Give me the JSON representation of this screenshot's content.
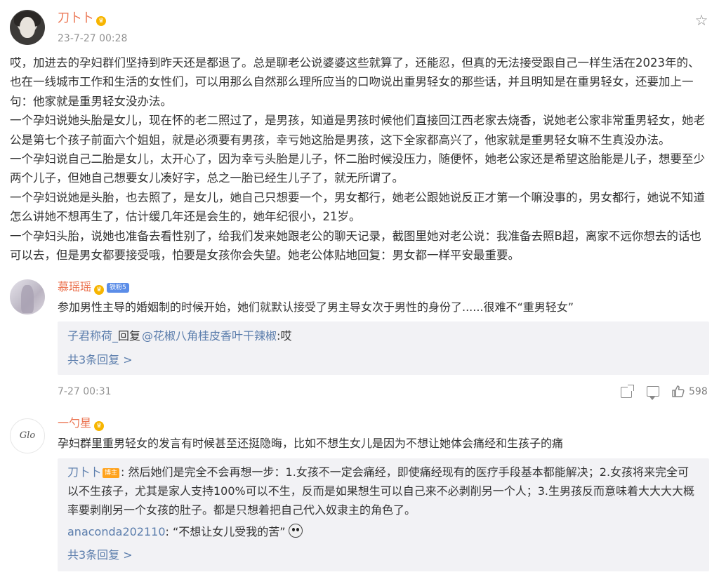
{
  "post": {
    "author": "刀卜卜",
    "time": "23-7-27 00:28",
    "paragraphs": [
      "哎，加进去的孕妇群们坚持到昨天还是都退了。总是聊老公说婆婆这些就算了，还能忍，但真的无法接受跟自己一样生活在2023年的、也在一线城市工作和生活的女性们，可以用那么自然那么理所应当的口吻说出重男轻女的那些话，并且明知是在重男轻女，还要加上一句：他家就是重男轻女没办法。",
      "一个孕妇说她头胎是女儿，现在怀的老二照过了，是男孩，知道是男孩时候他们直接回江西老家去烧香，说她老公家非常重男轻女，她老公是第七个孩子前面六个姐姐，就是必须要有男孩，幸亏她这胎是男孩，这下全家都高兴了，他家就是重男轻女嘛不生真没办法。",
      "一个孕妇说自己二胎是女儿，太开心了，因为幸亏头胎是儿子，怀二胎时候没压力，随便怀，她老公家还是希望这胎能是儿子，想要至少两个儿子，但她自己想要女儿凑好字，总之一胎已经生儿子了，就无所谓了。",
      "一个孕妇说她是头胎，也去照了，是女儿，她自己只想要一个，男女都行，她老公跟她说反正才第一个嘛没事的，男女都行，她说不知道怎么讲她不想再生了，估计缓几年还是会生的，她年纪很小，21岁。",
      "一个孕妇头胎，说她也准备去看性别了，给我们发来她跟老公的聊天记录，截图里她对老公说：我准备去照B超，离家不远你想去的话也可以去，但是男女都要接受哦，怕要是女孩你会失望。她老公体贴地回复：男女都一样平安最重要。"
    ]
  },
  "comments": [
    {
      "name": "慕瑶瑶",
      "fan_badge": "铁粉5",
      "text": "参加男性主导的婚姻制的时候开始，她们就默认接受了男主导女次于男性的身份了......很难不“重男轻女”",
      "reply_user": "子君称荷_",
      "reply_verb": "回复",
      "reply_mention": "@花椒八角桂皮香叶干辣椒",
      "reply_text": ":哎",
      "more_replies": "共3条回复 >",
      "time": "7-27 00:31",
      "likes": "598"
    },
    {
      "name": "一勺星",
      "avatar_text": "Glo",
      "text": "孕妇群里重男轻女的发言有时候甚至还挺隐晦，比如不想生女儿是因为不想让她体会痛经和生孩子的痛",
      "reply1_user": "刀卜卜",
      "reply1_badge": "博主",
      "reply1_text": ": 然后她们是完全不会再想一步：1.女孩不一定会痛经，即使痛经现有的医疗手段基本都能解决；2.女孩将来完全可以不生孩子，尤其是家人支持100%可以不生，反而是如果想生可以自己来不必剥削另一个人；3.生男孩反而意味着大大大大概率要剥削另一个女孩的肚子。都是只想着把自己代入奴隶主的角色了。",
      "reply2_user": "anaconda202110",
      "reply2_text": ": “不想让女儿受我的苦”",
      "more_replies": "共3条回复 >"
    }
  ],
  "icons": {
    "star": "star-icon",
    "share": "share-icon",
    "comment": "comment-icon",
    "like": "thumbs-up-icon",
    "vip": "crown-badge-icon"
  },
  "colors": {
    "username": "#eb7350",
    "link": "#5b7dac",
    "reply_bg": "#f2f2f5",
    "meta": "#939393"
  }
}
